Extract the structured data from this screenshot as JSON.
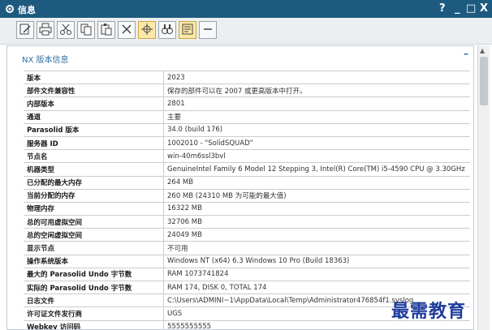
{
  "window": {
    "title": "信息",
    "help": "?",
    "minimize": "_",
    "maximize": "□",
    "close": "X"
  },
  "panel": {
    "title": "NX 版本信息",
    "collapse": "–"
  },
  "rows": [
    {
      "key": "版本",
      "value": "2023"
    },
    {
      "key": "部件文件兼容性",
      "value": "保存的部件可以在 2007 或更高版本中打开。"
    },
    {
      "key": "内部版本",
      "value": "2801"
    },
    {
      "key": "通道",
      "value": "主要"
    },
    {
      "key": "Parasolid 版本",
      "value": "34.0 (build 176)"
    },
    {
      "key": "服务器 ID",
      "value": "1002010 - \"SolidSQUAD\""
    },
    {
      "key": "节点名",
      "value": "win-40m6ssl3bvl"
    },
    {
      "key": "机器类型",
      "value": "GenuineIntel Family 6 Model 12 Stepping 3, Intel(R) Core(TM) i5-4590 CPU @ 3.30GHz"
    },
    {
      "key": "已分配的最大内存",
      "value": "264 MB"
    },
    {
      "key": "当前分配的内存",
      "value": "260 MB (24310 MB 为可能的最大值)"
    },
    {
      "key": "物理内存",
      "value": "16322 MB"
    },
    {
      "key": "总的可用虚拟空间",
      "value": "32706 MB"
    },
    {
      "key": "总的空闲虚拟空间",
      "value": "24049 MB"
    },
    {
      "key": "显示节点",
      "value": "不可用"
    },
    {
      "key": "操作系统版本",
      "value": "Windows NT (x64) 6.3 Windows 10 Pro (Build 18363)"
    },
    {
      "key": "最大的 Parasolid Undo 字节数",
      "value": "RAM 1073741824"
    },
    {
      "key": "实际的 Parasolid Undo 字节数",
      "value": "RAM 174, DISK 0, TOTAL 174"
    },
    {
      "key": "日志文件",
      "value": "C:\\Users\\ADMINI~1\\AppData\\Local\\Temp\\Administrator476854f1.syslog"
    },
    {
      "key": "许可证文件发行商",
      "value": "UGS"
    },
    {
      "key": "Webkey 访问码",
      "value": "5555555555"
    }
  ],
  "toolbar": {
    "icons": [
      "edit-icon",
      "print-icon",
      "cut-icon",
      "copy-icon",
      "paste-icon",
      "delete-icon",
      "crosshair-icon",
      "find-icon",
      "list-icon",
      "minus-icon"
    ]
  },
  "watermark": "最需教育",
  "colors": {
    "titlebar": "#1e5a7f",
    "accent": "#2f6ea3",
    "active_button": "#fbe9a8"
  }
}
